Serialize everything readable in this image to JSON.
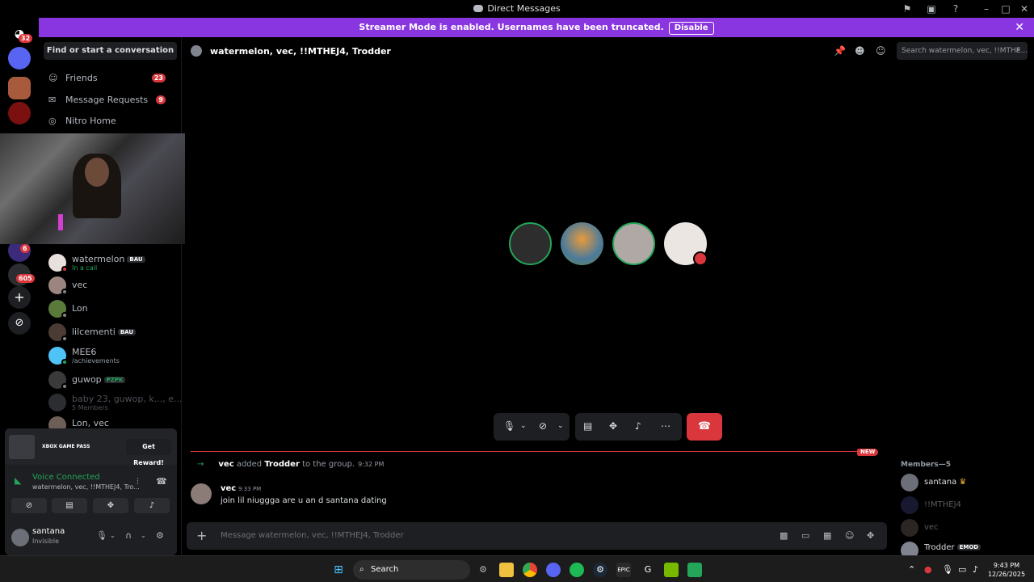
{
  "window": {
    "title": "Direct Messages"
  },
  "banner": {
    "text": "Streamer Mode is enabled. Usernames have been truncated.",
    "button": "Disable"
  },
  "servers": {
    "home_badge": "32",
    "badge_6": "6",
    "badge_605": "605"
  },
  "sidebar": {
    "find_button": "Find or start a conversation",
    "nav": [
      {
        "label": "Friends",
        "badge": "23"
      },
      {
        "label": "Message Requests",
        "badge": "9"
      },
      {
        "label": "Nitro Home",
        "badge": ""
      }
    ],
    "dms": [
      {
        "name": "watermelon",
        "tag": "BAU",
        "sub": "In a call"
      },
      {
        "name": "vec",
        "tag": "",
        "sub": ""
      },
      {
        "name": "Lon",
        "tag": "",
        "sub": ""
      },
      {
        "name": "lilcementi",
        "tag": "BAU",
        "sub": ""
      },
      {
        "name": "MEE6",
        "tag": "",
        "sub": "/achievements"
      },
      {
        "name": "guwop",
        "tag": "PZPK",
        "sub": ""
      },
      {
        "name": "baby 23, guwop, k..., e...",
        "tag": "",
        "sub": "5 Members"
      },
      {
        "name": "Lon, vec",
        "tag": "",
        "sub": ""
      }
    ]
  },
  "promo": {
    "logo": "XBOX GAME PASS",
    "button": "Get Reward!"
  },
  "voice": {
    "status": "Voice Connected",
    "channel": "watermelon, vec, !!MTHEJ4, Tro..."
  },
  "user": {
    "name": "santana",
    "status": "Invisible"
  },
  "header": {
    "title": "watermelon, vec, !!MTHEJ4, Trodder",
    "search_placeholder": "Search watermelon, vec, !!MTHE..."
  },
  "messages": {
    "new_tag": "NEW",
    "system": {
      "actor": "vec",
      "action": "added",
      "target": "Trodder",
      "suffix": "to the group.",
      "time": "9:32 PM"
    },
    "message": {
      "author": "vec",
      "time": "9:33 PM",
      "text": "join lil niuggga are u an d santana dating"
    }
  },
  "composer": {
    "placeholder": "Message watermelon, vec, !!MTHEJ4, Trodder"
  },
  "members": {
    "header": "Members—5",
    "list": [
      {
        "name": "santana",
        "tag": "♛"
      },
      {
        "name": "!!MTHEJ4",
        "tag": ""
      },
      {
        "name": "vec",
        "tag": ""
      },
      {
        "name": "Trodder",
        "tag": "EMOD"
      }
    ]
  },
  "taskbar": {
    "search": "Search",
    "time": "9:43 PM",
    "date": "12/26/2025"
  },
  "colors": {
    "accent": "#8a36e0",
    "danger": "#da373c",
    "online": "#23a55a"
  }
}
